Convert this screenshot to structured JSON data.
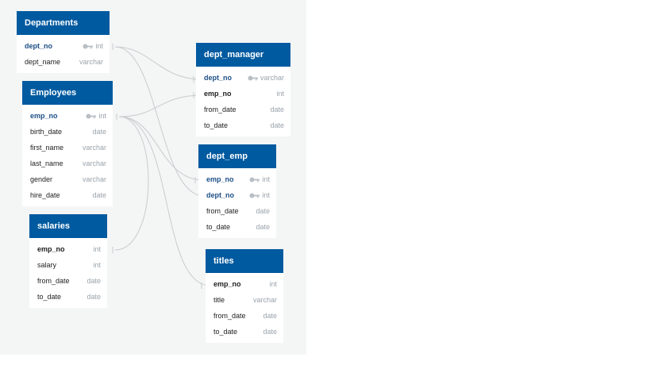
{
  "tables": {
    "departments": {
      "title": "Departments",
      "rows": [
        {
          "name": "dept_no",
          "type": "int",
          "pk": true,
          "key": true
        },
        {
          "name": "dept_name",
          "type": "varchar"
        }
      ]
    },
    "employees": {
      "title": "Employees",
      "rows": [
        {
          "name": "emp_no",
          "type": "int",
          "pk": true,
          "key": true
        },
        {
          "name": "birth_date",
          "type": "date"
        },
        {
          "name": "first_name",
          "type": "varchar"
        },
        {
          "name": "last_name",
          "type": "varchar"
        },
        {
          "name": "gender",
          "type": "varchar"
        },
        {
          "name": "hire_date",
          "type": "date"
        }
      ]
    },
    "salaries": {
      "title": "salaries",
      "rows": [
        {
          "name": "emp_no",
          "type": "int",
          "bold": true
        },
        {
          "name": "salary",
          "type": "int"
        },
        {
          "name": "from_date",
          "type": "date"
        },
        {
          "name": "to_date",
          "type": "date"
        }
      ]
    },
    "dept_manager": {
      "title": "dept_manager",
      "rows": [
        {
          "name": "dept_no",
          "type": "varchar",
          "pk": true,
          "key": true
        },
        {
          "name": "emp_no",
          "type": "int",
          "bold": true
        },
        {
          "name": "from_date",
          "type": "date"
        },
        {
          "name": "to_date",
          "type": "date"
        }
      ]
    },
    "dept_emp": {
      "title": "dept_emp",
      "rows": [
        {
          "name": "emp_no",
          "type": "int",
          "pk": true,
          "key": true
        },
        {
          "name": "dept_no",
          "type": "int",
          "pk": true,
          "key": true
        },
        {
          "name": "from_date",
          "type": "date"
        },
        {
          "name": "to_date",
          "type": "date"
        }
      ]
    },
    "titles": {
      "title": "titles",
      "rows": [
        {
          "name": "emp_no",
          "type": "int",
          "bold": true
        },
        {
          "name": "title",
          "type": "varchar"
        },
        {
          "name": "from_date",
          "type": "date"
        },
        {
          "name": "to_date",
          "type": "date"
        }
      ]
    }
  },
  "colors": {
    "header": "#005aa0",
    "primary_key": "#1d4f86",
    "type": "#9aa3ab",
    "link": "#c8cccf"
  }
}
